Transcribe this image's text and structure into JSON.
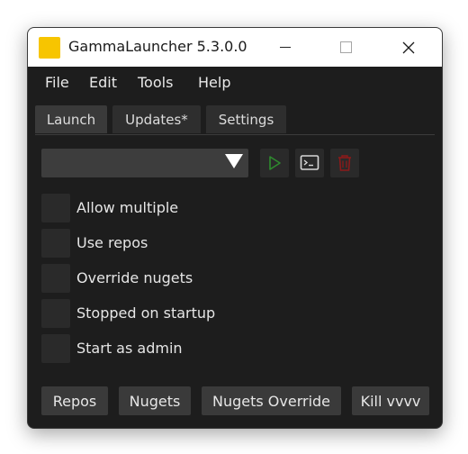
{
  "window": {
    "title": "GammaLauncher 5.3.0.0"
  },
  "menu": [
    "File",
    "Edit",
    "Tools",
    "Help"
  ],
  "tabs": [
    {
      "label": "Launch",
      "active": true
    },
    {
      "label": "Updates*",
      "active": false
    },
    {
      "label": "Settings",
      "active": false
    }
  ],
  "launch": {
    "combo_value": "",
    "checkboxes": [
      {
        "label": "Allow multiple",
        "checked": false
      },
      {
        "label": "Use repos",
        "checked": false
      },
      {
        "label": "Override nugets",
        "checked": false
      },
      {
        "label": "Stopped on startup",
        "checked": false
      },
      {
        "label": "Start as admin",
        "checked": false
      }
    ]
  },
  "actions": [
    "Repos",
    "Nugets",
    "Nugets Override",
    "Kill vvvv"
  ],
  "icons": {
    "run": "play-icon",
    "console": "terminal-icon",
    "delete": "trash-icon"
  },
  "colors": {
    "accent_app_icon": "#f7c500",
    "run_green": "#2e8b2e",
    "delete_red": "#8b1a1a",
    "background": "#1d1d1d"
  }
}
